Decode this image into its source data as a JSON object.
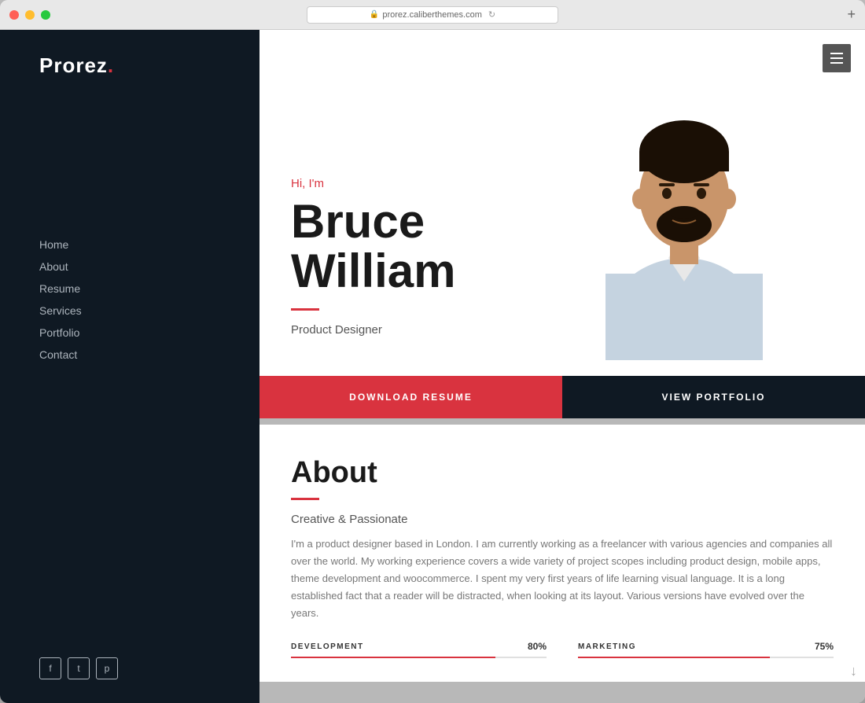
{
  "window": {
    "url": "prorez.caliberthemes.com"
  },
  "sidebar": {
    "logo": "Prorez",
    "logo_dot": ".",
    "nav_items": [
      {
        "label": "Home",
        "id": "home"
      },
      {
        "label": "About",
        "id": "about"
      },
      {
        "label": "Resume",
        "id": "resume"
      },
      {
        "label": "Services",
        "id": "services"
      },
      {
        "label": "Portfolio",
        "id": "portfolio"
      },
      {
        "label": "Contact",
        "id": "contact"
      }
    ],
    "social": [
      {
        "icon": "f",
        "name": "facebook"
      },
      {
        "icon": "t",
        "name": "twitter"
      },
      {
        "icon": "p",
        "name": "pinterest"
      }
    ]
  },
  "hero": {
    "greeting": "Hi, I'm",
    "name_line1": "Bruce",
    "name_line2": "William",
    "job_title": "Product Designer"
  },
  "cta": {
    "download_label": "DOWNLOAD RESUME",
    "portfolio_label": "VIEW PORTFOLIO"
  },
  "about": {
    "title": "About",
    "subtitle": "Creative & Passionate",
    "body": "I'm a product designer based in London. I am currently working as a freelancer with various agencies and companies all over the world. My working experience covers a wide variety of project scopes including product design, mobile apps, theme development and woocommerce. I spent my very first years of life learning visual language. It is a long established fact that a reader will be distracted, when looking at its layout. Various versions have evolved over the years.",
    "skills": [
      {
        "label": "DEVELOPMENT",
        "pct": 80,
        "pct_label": "80%"
      },
      {
        "label": "MARKETING",
        "pct": 75,
        "pct_label": "75%"
      }
    ]
  },
  "colors": {
    "accent_red": "#d9333f",
    "sidebar_bg": "#0f1923",
    "dark_bg": "#1a2530"
  }
}
